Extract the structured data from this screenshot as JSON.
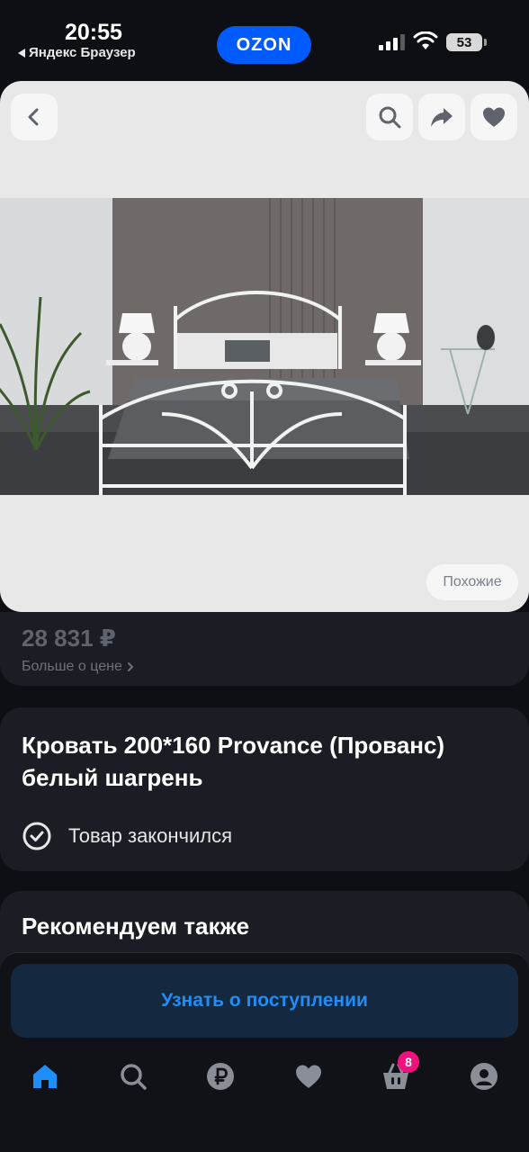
{
  "status_bar": {
    "time": "20:55",
    "back_app": "Яндекс Браузер",
    "brand_badge": "OZON",
    "battery": "53"
  },
  "image_card": {
    "similar_label": "Похожие",
    "icons": [
      "back-icon",
      "search-icon",
      "share-icon",
      "heart-icon"
    ]
  },
  "price": {
    "value": "28 831 ₽",
    "more_label": "Больше о цене"
  },
  "product": {
    "title": "Кровать 200*160 Provance (Прованс) белый шагрень",
    "status": "Товар закончился"
  },
  "recommend": {
    "title": "Рекомендуем также"
  },
  "notify": {
    "label": "Узнать о поступлении"
  },
  "nav": {
    "cart_count": "8",
    "items": [
      "home-icon",
      "search-icon",
      "ruble-icon",
      "favorites-icon",
      "cart-icon",
      "profile-icon"
    ],
    "active_color": "#1f8efa"
  },
  "colors": {
    "background": "#0d0f14",
    "card": "#1a1d24",
    "ozon_blue": "#005bff",
    "badge_pink": "#f1117e"
  }
}
